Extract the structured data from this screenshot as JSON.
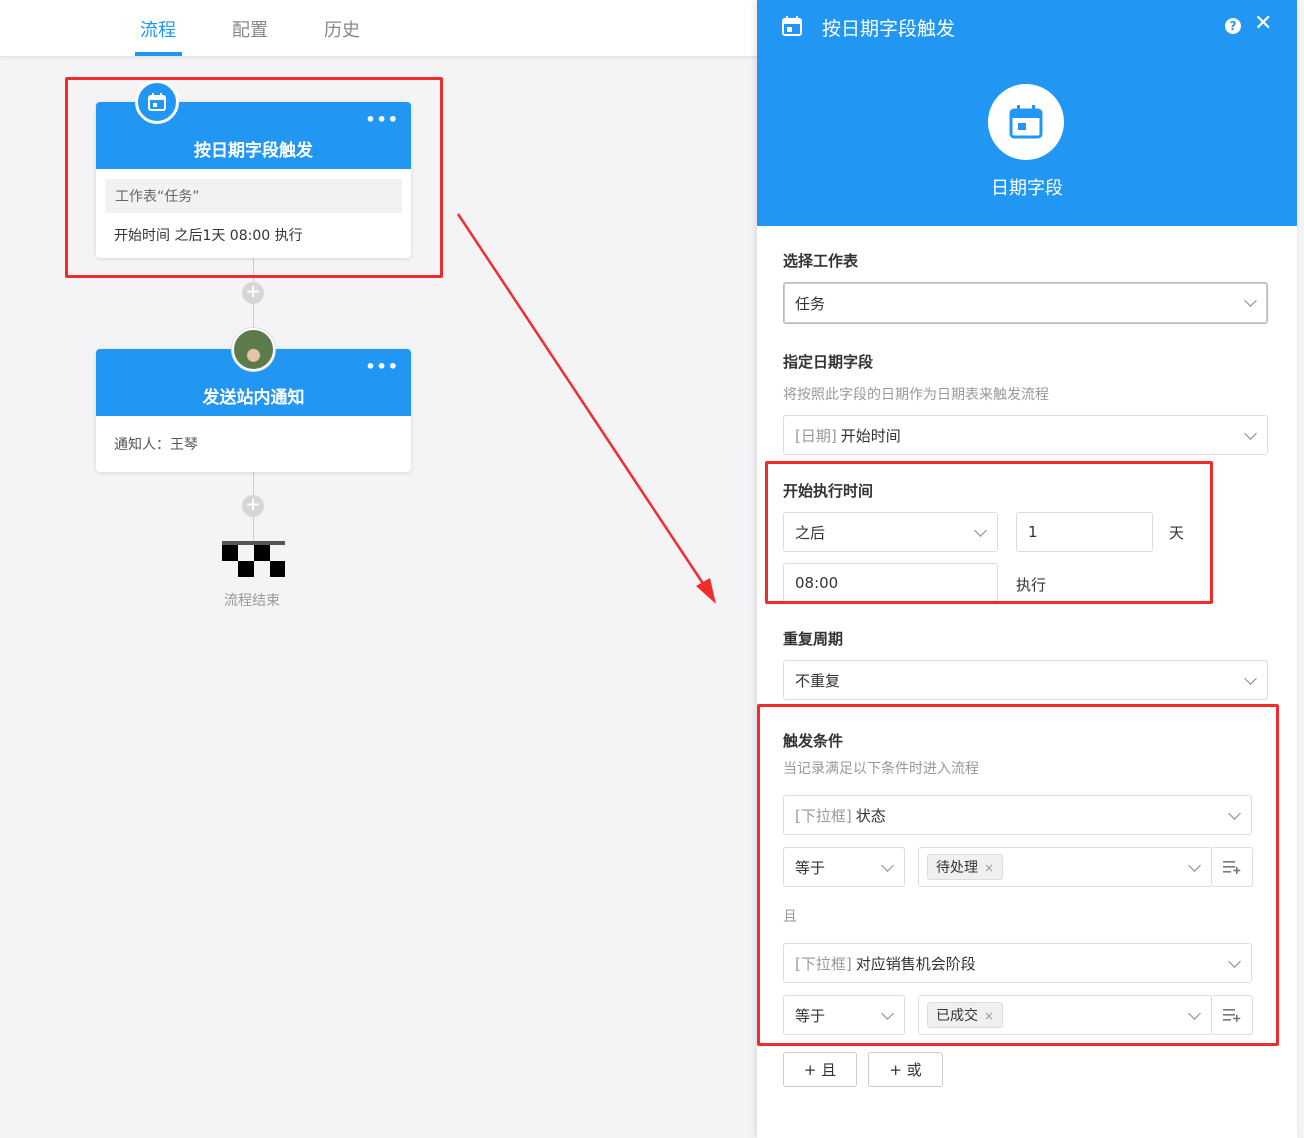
{
  "tabs": [
    {
      "label": "流程",
      "active": true
    },
    {
      "label": "配置",
      "active": false
    },
    {
      "label": "历史",
      "active": false
    }
  ],
  "flow": {
    "trigger_card": {
      "title": "按日期字段触发",
      "worksheet": "工作表“任务”",
      "schedule": "开始时间 之后1天 08:00 执行",
      "menu": "•••"
    },
    "notify_card": {
      "title": "发送站内通知",
      "recipient": "通知人：王琴",
      "menu": "•••"
    },
    "plus_symbol": "+",
    "end_label": "流程结束"
  },
  "panel": {
    "title": "按日期字段触发",
    "help": "?",
    "close": "✕",
    "node_caption": "日期字段",
    "worksheet_label": "选择工作表",
    "worksheet_value": "任务",
    "date_field_label": "指定日期字段",
    "date_field_hint": "将按照此字段的日期作为日期表来触发流程",
    "date_field_prefix": "[日期]",
    "date_field_value": "开始时间",
    "start_label": "开始执行时间",
    "start_direction": "之后",
    "start_amount": "1",
    "start_unit": "天",
    "start_time": "08:00",
    "start_suffix": "执行",
    "repeat_label": "重复周期",
    "repeat_value": "不重复",
    "cond_label": "触发条件",
    "cond_hint": "当记录满足以下条件时进入流程",
    "cond1_prefix": "[下拉框]",
    "cond1_field": "状态",
    "cond1_op": "等于",
    "cond1_tag": "待处理",
    "cond_join": "且",
    "cond2_prefix": "[下拉框]",
    "cond2_field": "对应销售机会阶段",
    "cond2_op": "等于",
    "cond2_tag": "已成交",
    "tag_remove": "×",
    "add_and": "+ 且",
    "add_or": "+ 或"
  },
  "colors": {
    "accent": "#2196f3",
    "highlight": "#f02d2d"
  }
}
